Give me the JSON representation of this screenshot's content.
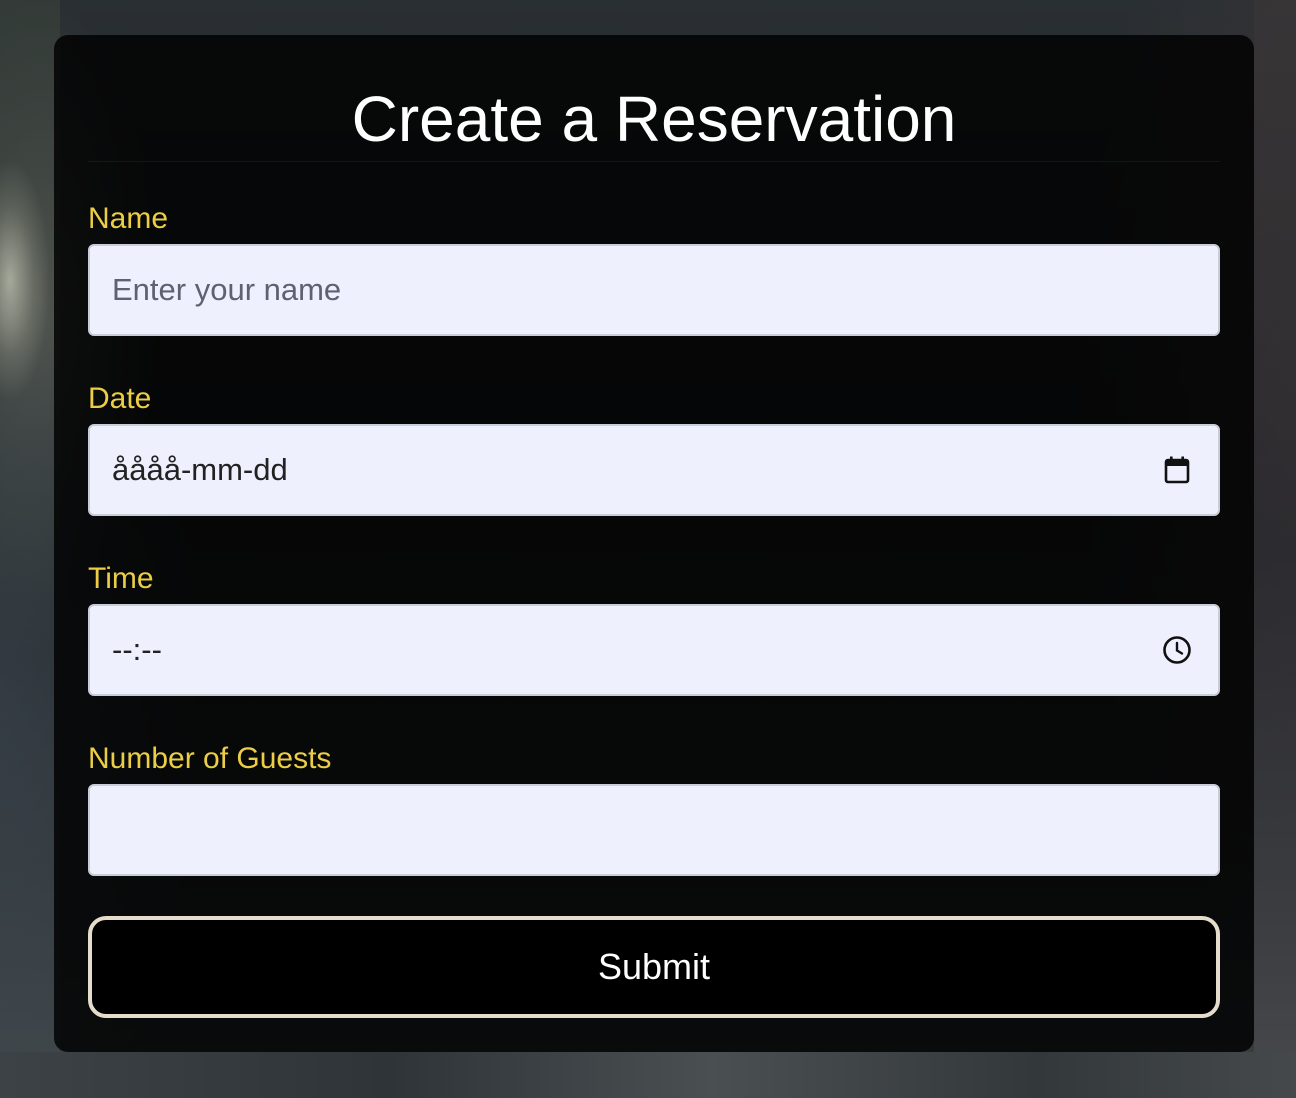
{
  "form": {
    "title": "Create a Reservation",
    "name_label": "Name",
    "name_placeholder": "Enter your name",
    "date_label": "Date",
    "date_value": "åååå-mm-dd",
    "date_icon": "calendar-icon",
    "time_label": "Time",
    "time_value": "--:--",
    "time_icon": "clock-icon",
    "guests_label": "Number of Guests",
    "guests_value": "",
    "submit_label": "Submit"
  },
  "colors": {
    "label": "#ecce46",
    "field_bg": "#eef0fe",
    "button_border": "#e6dccb",
    "card_bg": "rgba(0,0,0,0.82)"
  }
}
